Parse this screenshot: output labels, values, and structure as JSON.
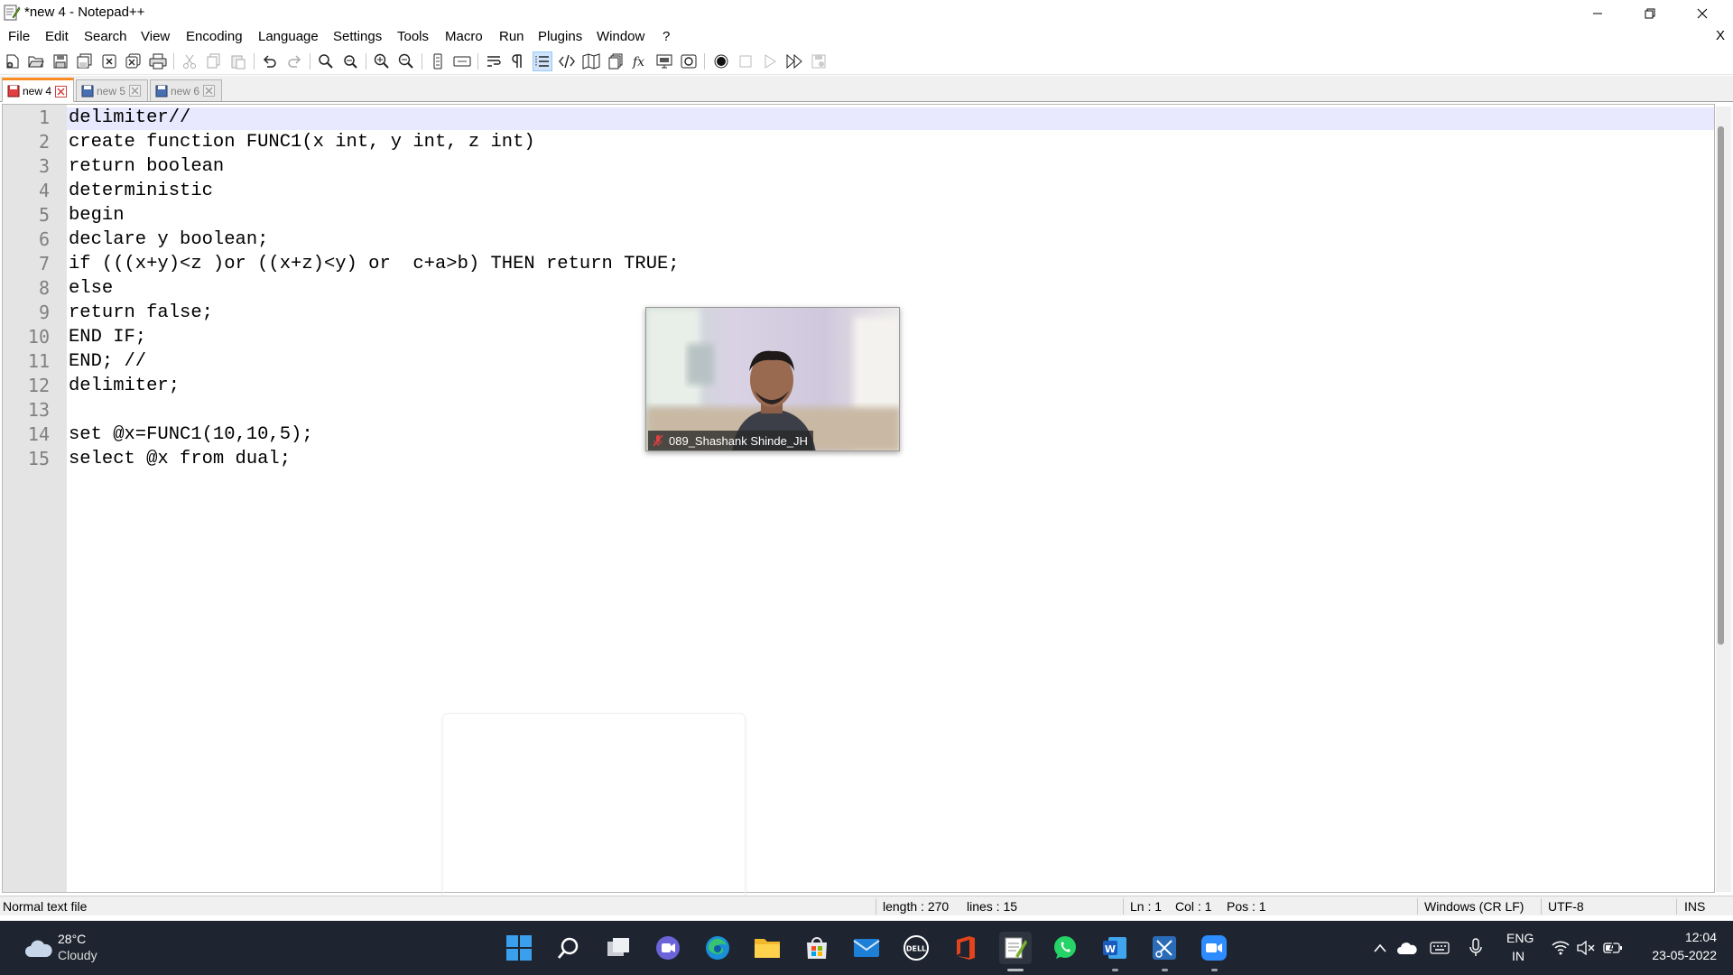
{
  "window": {
    "title": "*new 4 - Notepad++",
    "minimize_icon": "minimize-icon",
    "restore_icon": "restore-icon",
    "close_icon": "close-icon"
  },
  "menu": {
    "items": [
      "File",
      "Edit",
      "Search",
      "View",
      "Encoding",
      "Language",
      "Settings",
      "Tools",
      "Macro",
      "Run",
      "Plugins",
      "Window",
      "?"
    ],
    "close_label": "X"
  },
  "toolbar": {
    "icons": [
      "new-file-icon",
      "open-file-icon",
      "save-icon",
      "save-all-icon",
      "close-icon",
      "close-all-icon",
      "print-icon",
      "cut-icon",
      "copy-icon",
      "paste-icon",
      "undo-icon",
      "redo-icon",
      "find-icon",
      "replace-icon",
      "zoom-in-icon",
      "zoom-out-icon",
      "sync-vertical-icon",
      "sync-horizontal-icon",
      "word-wrap-icon",
      "show-all-characters-icon",
      "indent-guide-icon",
      "language-xml-icon",
      "document-map-icon",
      "document-list-icon",
      "function-list-icon",
      "folder-as-workspace-icon",
      "monitoring-icon",
      "record-macro-icon",
      "stop-recording-icon",
      "playback-icon",
      "run-macro-multiple-icon",
      "save-macro-icon"
    ]
  },
  "tabs": [
    {
      "label": "new 4",
      "active": true
    },
    {
      "label": "new 5",
      "active": false
    },
    {
      "label": "new 6",
      "active": false
    }
  ],
  "editor": {
    "lines": [
      {
        "num": "1",
        "text": "delimiter//"
      },
      {
        "num": "2",
        "text": "create function FUNC1(x int, y int, z int)"
      },
      {
        "num": "3",
        "text": "return boolean"
      },
      {
        "num": "4",
        "text": "deterministic"
      },
      {
        "num": "5",
        "text": "begin"
      },
      {
        "num": "6",
        "text": "declare y boolean;"
      },
      {
        "num": "7",
        "text": "if (((x+y)<z )or ((x+z)<y) or  c+a>b) THEN return TRUE;"
      },
      {
        "num": "8",
        "text": "else"
      },
      {
        "num": "9",
        "text": "return false;"
      },
      {
        "num": "10",
        "text": "END IF;"
      },
      {
        "num": "11",
        "text": "END; //"
      },
      {
        "num": "12",
        "text": "delimiter;"
      },
      {
        "num": "13",
        "text": ""
      },
      {
        "num": "14",
        "text": "set @x=FUNC1(10,10,5);"
      },
      {
        "num": "15",
        "text": "select @x from dual;"
      }
    ]
  },
  "video_tile": {
    "participant_name": "089_Shashank Shinde_JH",
    "mic_icon": "mic-muted-icon"
  },
  "statusbar": {
    "file_type": "Normal text file",
    "length": "length : 270",
    "lines": "lines : 15",
    "ln": "Ln : 1",
    "col": "Col : 1",
    "pos": "Pos : 1",
    "eol": "Windows (CR LF)",
    "encoding": "UTF-8",
    "mode": "INS"
  },
  "taskbar": {
    "weather_temp": "28°C",
    "weather_desc": "Cloudy",
    "apps": [
      "windows-start-icon",
      "search-icon",
      "task-view-icon",
      "teams-chat-icon",
      "edge-icon",
      "file-explorer-icon",
      "microsoft-store-icon",
      "mail-icon",
      "dell-icon",
      "office-icon",
      "notepad-plus-plus-icon",
      "whatsapp-icon",
      "word-icon",
      "snipping-tool-icon",
      "zoom-icon"
    ],
    "lang_top": "ENG",
    "lang_bottom": "IN",
    "time": "12:04",
    "date": "23-05-2022"
  }
}
